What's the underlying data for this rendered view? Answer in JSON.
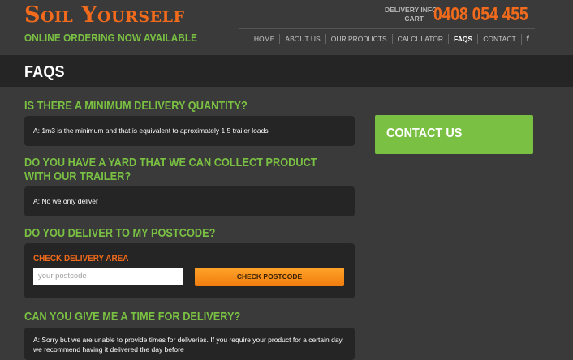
{
  "header": {
    "logo_text": "Soil Yourself",
    "tagline": "ONLINE ORDERING NOW AVAILABLE",
    "info_links": [
      "DELIVERY INFO",
      "CART"
    ],
    "phone": "0408 054 455",
    "nav": [
      {
        "label": "HOME",
        "active": false
      },
      {
        "label": "ABOUT US",
        "active": false
      },
      {
        "label": "OUR PRODUCTS",
        "active": false
      },
      {
        "label": "CALCULATOR",
        "active": false
      },
      {
        "label": "FAQS",
        "active": true
      },
      {
        "label": "CONTACT",
        "active": false
      }
    ],
    "facebook_icon": "f"
  },
  "page": {
    "title": "FAQS"
  },
  "faqs": [
    {
      "question": "IS THERE A MINIMUM DELIVERY QUANTITY?",
      "answer": "A: 1m3 is the minimum and that is equivalent to aproximately 1.5 trailer loads"
    },
    {
      "question": "DO YOU HAVE A YARD THAT WE CAN COLLECT PRODUCT WITH OUR TRAILER?",
      "answer": "A: No we only deliver"
    },
    {
      "question": "DO YOU DELIVER TO MY POSTCODE?"
    },
    {
      "question": "CAN YOU GIVE ME A TIME FOR DELIVERY?",
      "answer": "A: Sorry but we are unable to provide times for deliveries. If you require your product for a certain day, we recommend having it delivered the day before"
    }
  ],
  "postcode_check": {
    "label": "CHECK DELIVERY AREA",
    "placeholder": "your postcode",
    "value": "",
    "button": "CHECK POSTCODE"
  },
  "sidebar": {
    "contact_label": "CONTACT US"
  },
  "colors": {
    "accent_orange": "#f26a1b",
    "accent_green": "#7ac143",
    "background": "#3a3a3a",
    "panel": "#252525"
  }
}
